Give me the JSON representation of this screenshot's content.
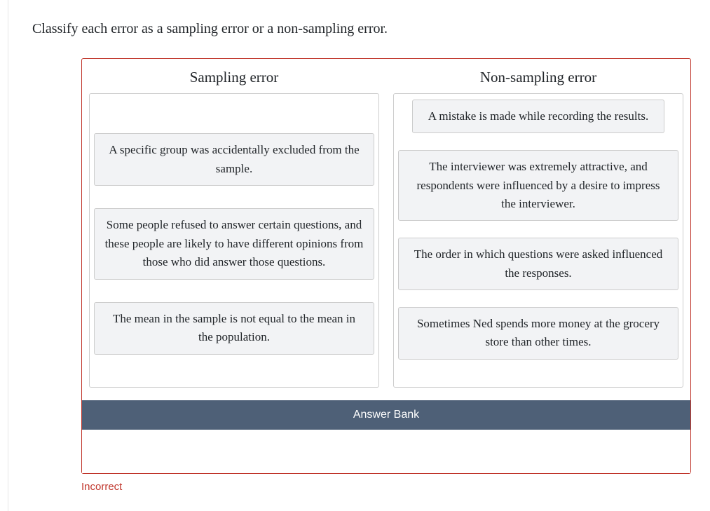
{
  "prompt": "Classify each error as a sampling error or a non-sampling error.",
  "columns": {
    "left": {
      "title": "Sampling error",
      "cards": [
        "A specific group was accidentally excluded from the sample.",
        "Some people refused to answer certain questions, and these people are likely to have different opinions from those who did answer those questions.",
        "The mean in the sample is not equal to the mean in the population."
      ]
    },
    "right": {
      "title": "Non-sampling error",
      "cards": [
        "A mistake is made while recording the results.",
        "The interviewer was extremely attractive, and respondents were influenced by a desire to impress the interviewer.",
        "The order in which questions were asked influenced the responses.",
        "Sometimes Ned spends more money at the grocery store than other times."
      ]
    }
  },
  "answer_bank": {
    "label": "Answer Bank",
    "items": []
  },
  "status": "Incorrect"
}
